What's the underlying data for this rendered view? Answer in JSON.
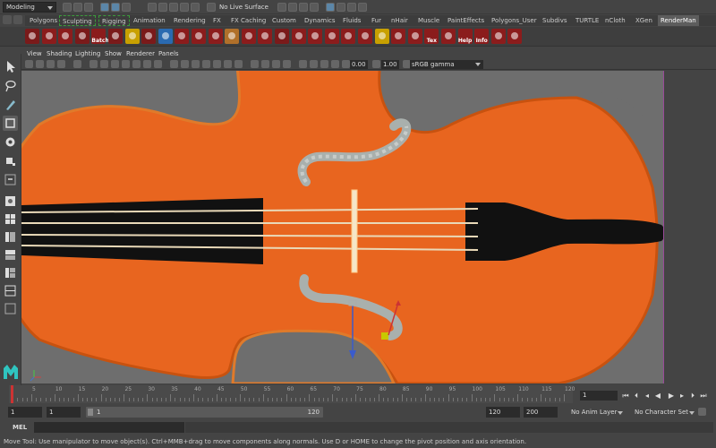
{
  "status_line": {
    "mode": "Modeling",
    "live_surface": "No Live Surface"
  },
  "shelf_tabs": [
    {
      "label": "Polygons"
    },
    {
      "label": "Sculpting"
    },
    {
      "label": "Rigging"
    },
    {
      "label": "Animation"
    },
    {
      "label": "Rendering"
    },
    {
      "label": "FX"
    },
    {
      "label": "FX Caching"
    },
    {
      "label": "Custom"
    },
    {
      "label": "Dynamics"
    },
    {
      "label": "Fluids"
    },
    {
      "label": "Fur"
    },
    {
      "label": "nHair"
    },
    {
      "label": "Muscle"
    },
    {
      "label": "PaintEffects"
    },
    {
      "label": "Polygons_User"
    },
    {
      "label": "Subdivs"
    },
    {
      "label": "TURTLE"
    },
    {
      "label": "nCloth"
    },
    {
      "label": "XGen"
    },
    {
      "label": "RenderMan"
    }
  ],
  "shelf": {
    "batch_label": "Batch",
    "tex_label": "Tex",
    "help_label": "Help",
    "info_label": "Info",
    "colors": [
      "#7a1a1a",
      "#8b1c1c",
      "#8b1c1c",
      "#7a1a1a",
      "#8b1c1c",
      "#7a1a1a",
      "#c8a000",
      "#7a1a1a",
      "#2a6ab0",
      "#8b1c1c",
      "#8b1c1c",
      "#8b1c1c",
      "#b0702a",
      "#8b1c1c",
      "#8b1c1c",
      "#7a1a1a",
      "#8b1c1c",
      "#8b1c1c",
      "#8b1c1c",
      "#8b1c1c",
      "#8b1c1c",
      "#c8a000",
      "#8b1c1c",
      "#8b1c1c",
      "#8b1c1c",
      "#8b1c1c",
      "#8b1c1c",
      "#8b1c1c",
      "#8b1c1c",
      "#8b1c1c"
    ]
  },
  "panel_menu": [
    "View",
    "Shading",
    "Lighting",
    "Show",
    "Renderer",
    "Panels"
  ],
  "panel_toolbar": {
    "exposure": "0.00",
    "gamma": "1.00",
    "color_space": "sRGB gamma"
  },
  "viewport": {
    "background_color": "#6e6e6e",
    "body_color": "#e8651f",
    "fingerboard_color": "#111111",
    "string_color": "#e9d9b8"
  },
  "time_slider": {
    "ticks": [
      "5",
      "10",
      "15",
      "20",
      "25",
      "30",
      "35",
      "40",
      "45",
      "50",
      "55",
      "60",
      "65",
      "70",
      "75",
      "80",
      "85",
      "90",
      "95",
      "100",
      "105",
      "110",
      "115",
      "120"
    ],
    "current_frame": "1"
  },
  "range": {
    "start": "1",
    "anim_start": "1",
    "range_start_marker": "1",
    "range_end": "120",
    "anim_end": "120",
    "max_end": "200",
    "anim_layer": "No Anim Layer",
    "character_set": "No Character Set"
  },
  "command_line": {
    "label": "MEL"
  },
  "help_line": "Move Tool: Use manipulator to move object(s). Ctrl+MMB+drag to move components along normals. Use D or HOME to change the pivot position and axis orientation."
}
